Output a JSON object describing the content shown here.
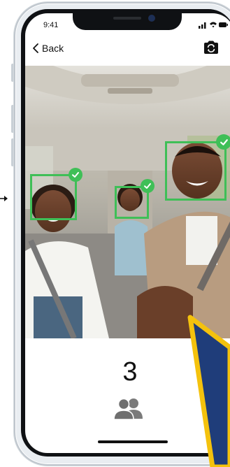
{
  "status_bar": {
    "time": "9:41"
  },
  "nav": {
    "back_label": "Back"
  },
  "result": {
    "face_count": "3"
  },
  "icons": {
    "back": "chevron-left-icon",
    "flip_camera": "camera-flip-icon",
    "people": "people-icon",
    "check": "check-icon"
  },
  "colors": {
    "detection": "#3fbf57",
    "pointer_fill": "#1f3d7a",
    "pointer_border": "#f4c20d",
    "text": "#111111"
  }
}
